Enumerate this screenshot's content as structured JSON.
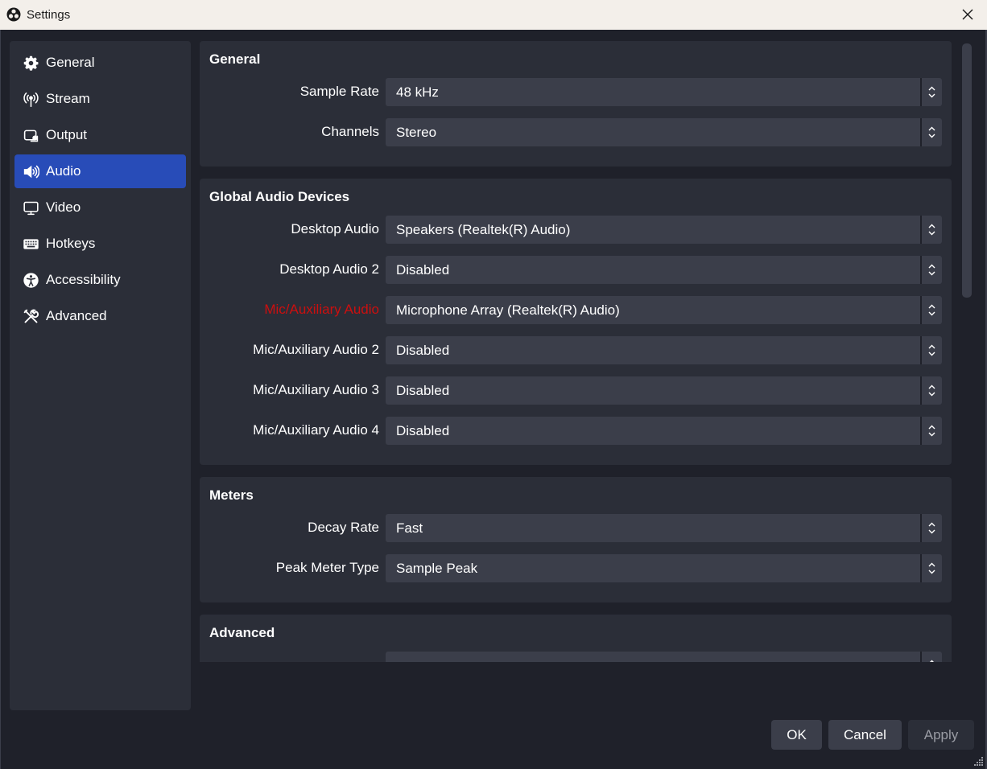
{
  "window": {
    "title": "Settings",
    "icon": "obs-logo-icon"
  },
  "sidebar": {
    "items": [
      {
        "label": "General",
        "icon": "gear-icon"
      },
      {
        "label": "Stream",
        "icon": "antenna-icon"
      },
      {
        "label": "Output",
        "icon": "output-icon"
      },
      {
        "label": "Audio",
        "icon": "speaker-icon",
        "active": true
      },
      {
        "label": "Video",
        "icon": "monitor-icon"
      },
      {
        "label": "Hotkeys",
        "icon": "keyboard-icon"
      },
      {
        "label": "Accessibility",
        "icon": "accessibility-icon"
      },
      {
        "label": "Advanced",
        "icon": "tools-icon"
      }
    ],
    "active_color": "#284cb8"
  },
  "general": {
    "title": "General",
    "rows": [
      {
        "label": "Sample Rate",
        "value": "48 kHz"
      },
      {
        "label": "Channels",
        "value": "Stereo"
      }
    ]
  },
  "global_audio": {
    "title": "Global Audio Devices",
    "rows": [
      {
        "label": "Desktop Audio",
        "value": "Speakers (Realtek(R) Audio)"
      },
      {
        "label": "Desktop Audio 2",
        "value": "Disabled"
      },
      {
        "label": "Mic/Auxiliary Audio",
        "value": "Microphone Array (Realtek(R) Audio)",
        "highlight": true
      },
      {
        "label": "Mic/Auxiliary Audio 2",
        "value": "Disabled"
      },
      {
        "label": "Mic/Auxiliary Audio 3",
        "value": "Disabled"
      },
      {
        "label": "Mic/Auxiliary Audio 4",
        "value": "Disabled"
      }
    ],
    "highlight_color": "#cc0f0f"
  },
  "meters": {
    "title": "Meters",
    "rows": [
      {
        "label": "Decay Rate",
        "value": "Fast"
      },
      {
        "label": "Peak Meter Type",
        "value": "Sample Peak"
      }
    ]
  },
  "advanced": {
    "title": "Advanced"
  },
  "buttons": {
    "ok": "OK",
    "cancel": "Cancel",
    "apply": "Apply"
  }
}
